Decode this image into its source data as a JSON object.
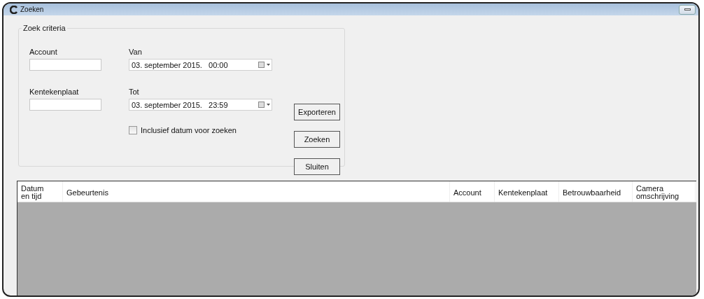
{
  "window": {
    "title": "Zoeken"
  },
  "criteria": {
    "title": "Zoek criteria",
    "account": {
      "label": "Account"
    },
    "plate": {
      "label": "Kentekenplaat"
    },
    "from": {
      "label": "Van",
      "value": "03. september 2015.   00:00"
    },
    "to": {
      "label": "Tot",
      "value": "03. september 2015.   23:59"
    },
    "include_date": {
      "label": "Inclusief datum voor zoeken",
      "checked": false
    }
  },
  "buttons": [
    "Exporteren",
    "Zoeken",
    "Sluiten"
  ],
  "table": {
    "columns": [
      "Datum en tijd",
      "Gebeurtenis",
      "Account",
      "Kentekenplaat",
      "Betrouwbaarheid",
      "Camera omschrijving"
    ]
  }
}
